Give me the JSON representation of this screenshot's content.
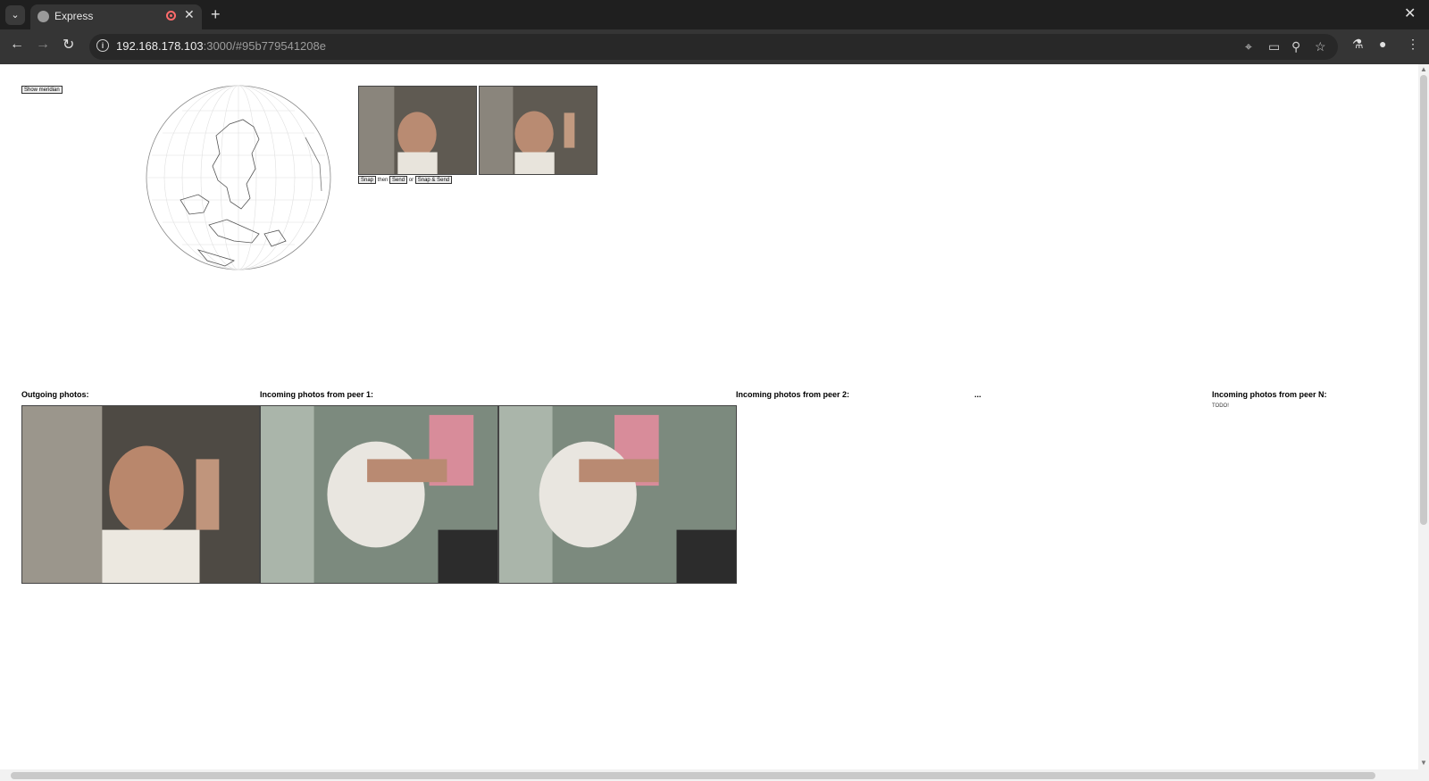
{
  "browser": {
    "tab_title": "Express",
    "new_tab_glyph": "+",
    "close_glyph": "✕",
    "url_host": "192.168.178.103",
    "url_rest": ":3000/#95b779541208e",
    "icons": [
      "tab-list-icon",
      "globe-favicon-icon",
      "recording-icon",
      "close-icon",
      "new-tab-icon",
      "back-icon",
      "forward-icon",
      "reload-icon",
      "info-icon",
      "location-icon",
      "camera-icon",
      "zoom-icon",
      "star-icon",
      "labs-icon",
      "profile-icon",
      "menu-icon"
    ]
  },
  "controls": {
    "show_meridian": "Show meridian",
    "snap": "Snap",
    "then": "then",
    "send": "Send",
    "or": "or",
    "snap_send": "Snap & Send"
  },
  "sections": {
    "outgoing": "Outgoing photos:",
    "peer1": "Incoming photos from peer 1:",
    "peer2": "Incoming photos from peer 2:",
    "ellipsis": "...",
    "peerN": "Incoming photos from peer N:",
    "todo": "TODO!"
  },
  "colors": {
    "chrome_dark": "#1f1f1f",
    "chrome_toolbar": "#353535",
    "recording": "#ff6b6b"
  }
}
